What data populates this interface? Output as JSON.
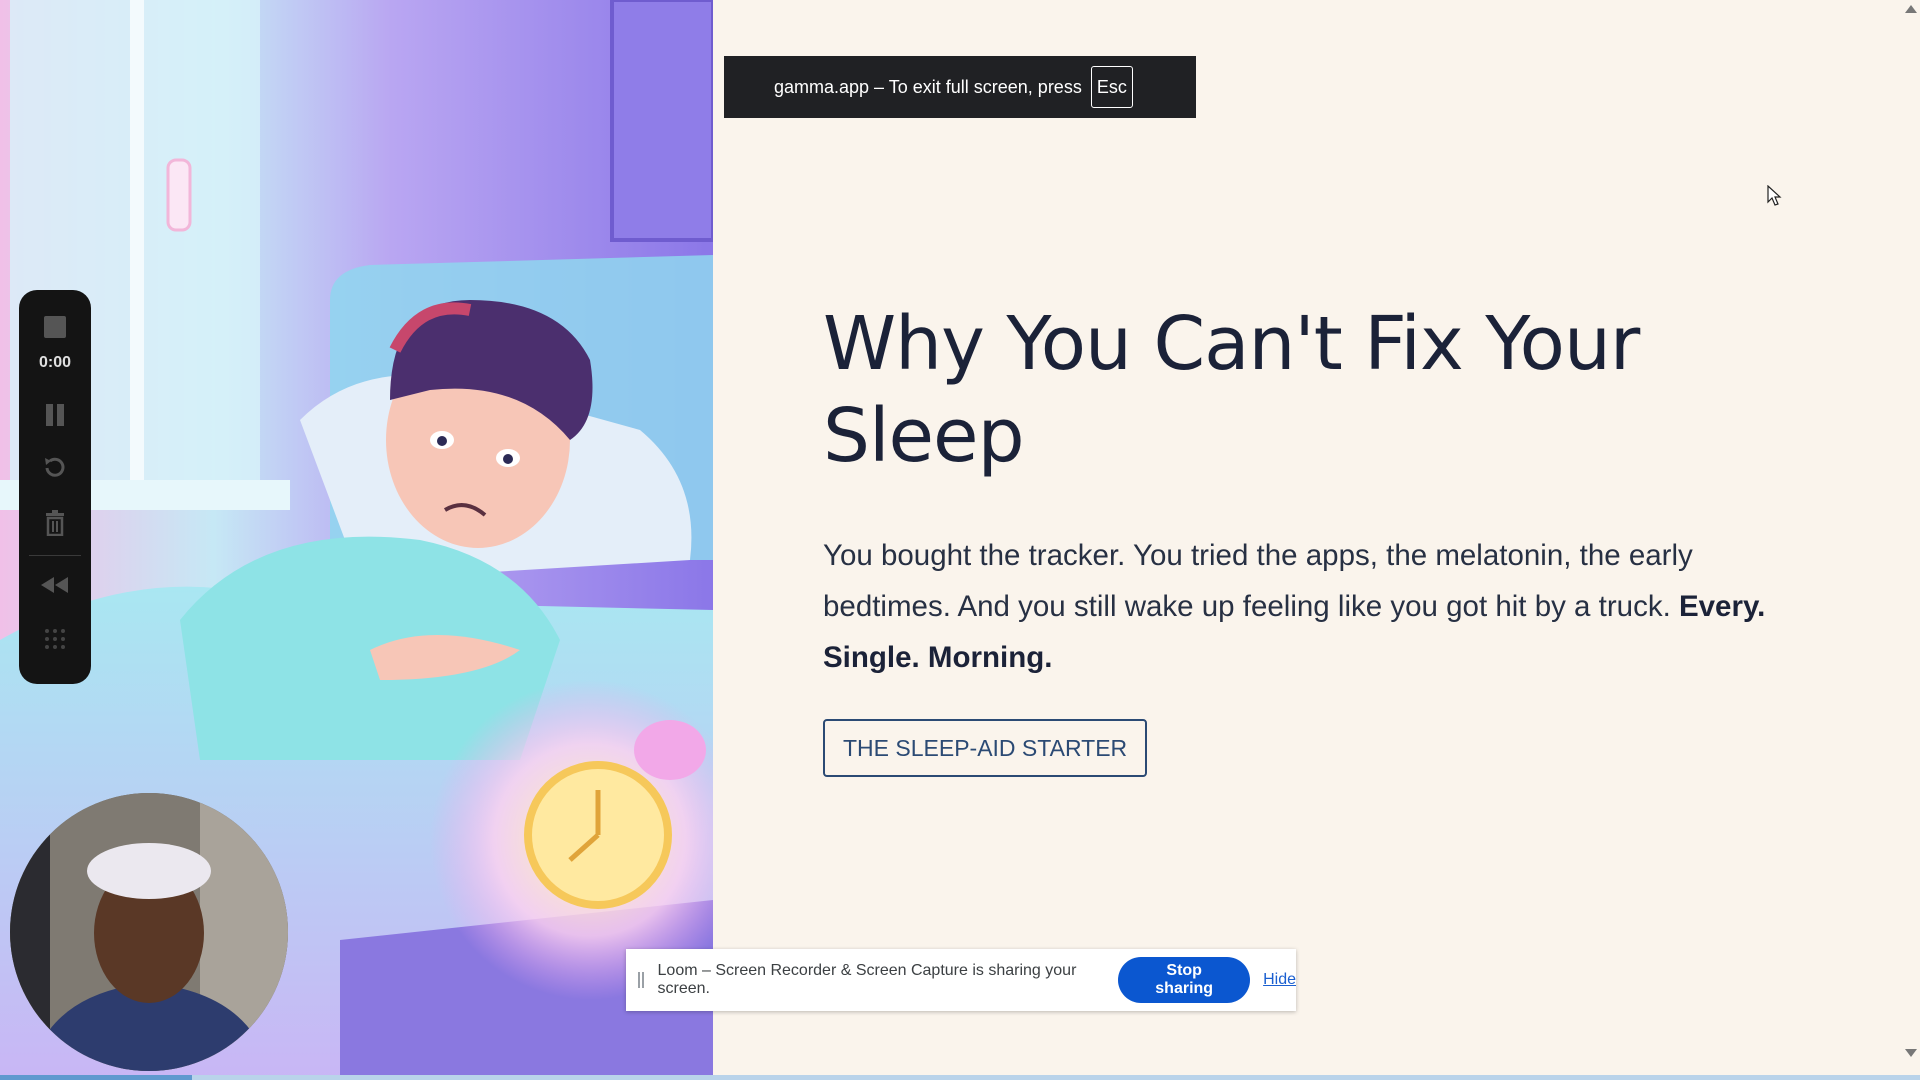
{
  "fullscreen_toast": {
    "message": "gamma.app – To exit full screen, press",
    "key": "Esc"
  },
  "slide": {
    "title": "Why You Can't Fix Your Sleep",
    "body": "You bought the tracker. You tried the apps, the melatonin, the early bedtimes. And you still wake up feeling like you got hit by a truck.",
    "body_emphasis": "Every. Single. Morning.",
    "cta_label": "THE SLEEP-AID STARTER"
  },
  "loom_controls": {
    "timer": "0:00",
    "icons": [
      "stop-icon",
      "pause-icon",
      "restart-icon",
      "delete-icon",
      "rewind-icon",
      "grid-icon"
    ]
  },
  "share_bar": {
    "message": "Loom – Screen Recorder & Screen Capture is sharing your screen.",
    "stop_label": "Stop sharing",
    "hide_label": "Hide"
  },
  "progress": {
    "fraction": 0.1
  },
  "colors": {
    "slide_bg": "#faf4ec",
    "title": "#1b2238",
    "cta_border": "#2b4a74",
    "stop_button": "#0b57d0",
    "loom_bar": "#141414"
  }
}
